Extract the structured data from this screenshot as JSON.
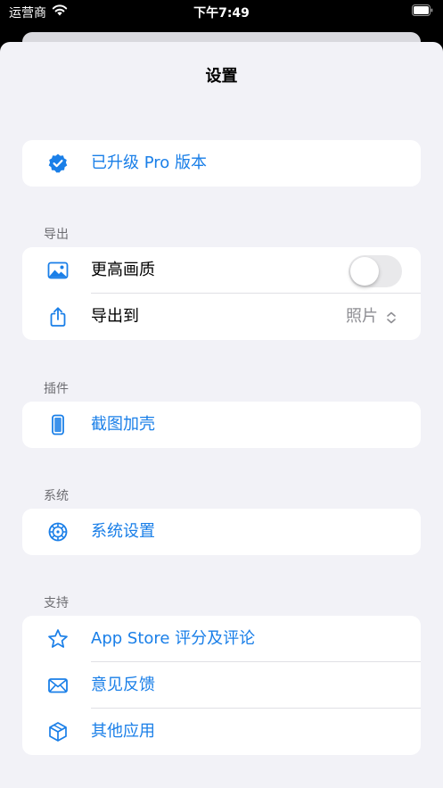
{
  "status_bar": {
    "carrier": "运营商",
    "time": "下午7:49"
  },
  "sheet": {
    "title": "设置"
  },
  "pro": {
    "label": "已升级 Pro 版本"
  },
  "export": {
    "header": "导出",
    "quality_label": "更高画质",
    "quality_enabled": false,
    "destination_label": "导出到",
    "destination_value": "照片"
  },
  "plugins": {
    "header": "插件",
    "frame_label": "截图加壳"
  },
  "system": {
    "header": "系统",
    "settings_label": "系统设置"
  },
  "support": {
    "header": "支持",
    "rate_label": "App Store 评分及评论",
    "feedback_label": "意见反馈",
    "other_apps_label": "其他应用"
  },
  "colors": {
    "accent": "#1a7fe8",
    "background": "#f2f2f7",
    "card": "#ffffff",
    "secondary_text": "#8e8e93"
  }
}
